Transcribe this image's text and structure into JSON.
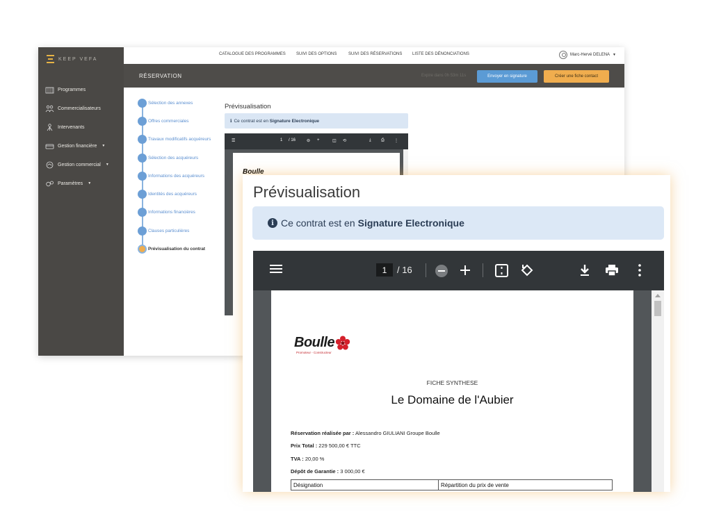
{
  "app": {
    "logo_text": "KEEP VEFA"
  },
  "sidebar": {
    "items": [
      {
        "label": "Programmes",
        "icon": "building-icon"
      },
      {
        "label": "Commercialisateurs",
        "icon": "people-icon"
      },
      {
        "label": "Intervenants",
        "icon": "worker-icon"
      },
      {
        "label": "Gestion financière",
        "icon": "wallet-icon",
        "has_caret": true
      },
      {
        "label": "Gestion commercial",
        "icon": "handshake-icon",
        "has_caret": true
      },
      {
        "label": "Paramètres",
        "icon": "gears-icon",
        "has_caret": true
      }
    ]
  },
  "topnav": {
    "links": [
      "CATALOGUE DES PROGRAMMES",
      "SUIVI DES OPTIONS",
      "SUIVI DES RÉSERVATIONS",
      "LISTE DES DÉNONCIATIONS"
    ],
    "user": "Marc-Hervé DELENA"
  },
  "subheader": {
    "title": "RÉSERVATION",
    "expire": "Expire dans 0h 53m 11s",
    "send_button": "Envoyer en signature",
    "create_button": "Créer une fiche contact"
  },
  "steps": [
    {
      "label": "Sélection des annexes"
    },
    {
      "label": "Offres commerciales"
    },
    {
      "label": "Travaux modificatifs acquéreurs"
    },
    {
      "label": "Sélection des acquéreurs"
    },
    {
      "label": "Informations des acquéreurs"
    },
    {
      "label": "Identités des acquéreurs"
    },
    {
      "label": "Informations financières"
    },
    {
      "label": "Clauses particulières"
    },
    {
      "label": "Prévisualisation du contrat",
      "current": true
    }
  ],
  "preview": {
    "title": "Prévisualisation",
    "alert_prefix": "Ce contrat est en",
    "alert_bold": "Signature Electronique"
  },
  "pdf": {
    "page": "1",
    "total": "/ 16",
    "brand_name": "Boulle",
    "brand_sub": "Promoteur - Constructeur",
    "doc_subtitle": "FICHE SYNTHESE",
    "doc_title": "Le Domaine de l'Aubier",
    "fields": [
      {
        "label": "Réservation réalisée par :",
        "value": "Alessandro GIULIANI   Groupe Boulle"
      },
      {
        "label": "Prix Total :",
        "value": "229 500,00 €  TTC"
      },
      {
        "label": "TVA :",
        "value": "20,00 %"
      },
      {
        "label": "Dépôt de Garantie :",
        "value": "3 000,00 €"
      }
    ],
    "table_headers": [
      "Désignation",
      "Répartition du prix de vente"
    ]
  },
  "colors": {
    "sidebar_bg": "#4a4845",
    "primary": "#5b9bd5",
    "warning": "#f0ad4e",
    "alert_bg": "#dce8f6",
    "pdf_toolbar": "#323639"
  }
}
